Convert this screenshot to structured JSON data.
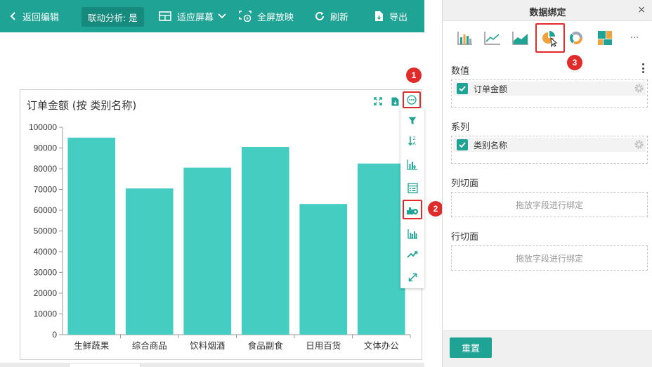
{
  "toolbar": {
    "back_label": "返回编辑",
    "linked_analysis_label": "联动分析: 是",
    "fit_screen_label": "适应屏幕",
    "fullscreen_label": "全屏放映",
    "refresh_label": "刷新",
    "export_label": "导出"
  },
  "chart": {
    "title": "订单金额 (按 类别名称)"
  },
  "chart_data": {
    "type": "bar",
    "title": "订单金额 (按 类别名称)",
    "categories": [
      "生鲜蔬果",
      "综合商品",
      "饮料烟酒",
      "食品副食",
      "日用百货",
      "文体办公"
    ],
    "values": [
      95000,
      70500,
      80500,
      90500,
      63000,
      82500
    ],
    "ylim": [
      0,
      100000
    ],
    "yticks": [
      0,
      10000,
      20000,
      30000,
      40000,
      50000,
      60000,
      70000,
      80000,
      90000,
      100000
    ],
    "grid": false,
    "bar_color": "#45cdc2"
  },
  "annotations": {
    "badge1": "1",
    "badge2": "2",
    "badge3": "3"
  },
  "panel": {
    "title": "数据绑定",
    "close_glyph": "×",
    "more_chart_types": "···",
    "values_label": "数值",
    "values_field": "订单金额",
    "series_label": "系列",
    "series_field": "类别名称",
    "col_slice_label": "列切面",
    "col_slice_placeholder": "拖放字段进行绑定",
    "row_slice_label": "行切面",
    "row_slice_placeholder": "拖放字段进行绑定",
    "reset_label": "重置"
  },
  "colors": {
    "accent": "#1fa394",
    "bar": "#45cdc2",
    "highlight": "#e02b2b"
  }
}
